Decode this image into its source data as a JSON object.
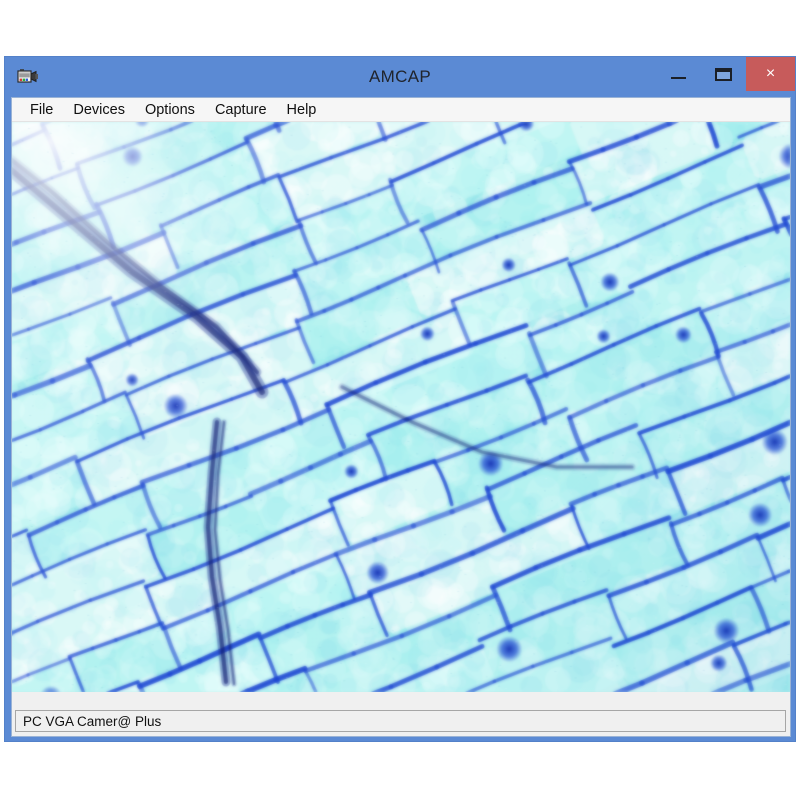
{
  "window": {
    "title": "AMCAP",
    "icon": "camcorder-icon",
    "controls": {
      "minimize": "—",
      "maximize": "❐",
      "close": "×"
    }
  },
  "menu": {
    "items": [
      {
        "label": "File"
      },
      {
        "label": "Devices"
      },
      {
        "label": "Options"
      },
      {
        "label": "Capture"
      },
      {
        "label": "Help"
      }
    ]
  },
  "preview": {
    "description": "Live camera preview of onion epidermis cells under microscope",
    "cell_wall_color": "#1b44d2",
    "cell_interior_color": "#b6f2ef",
    "nucleus_color": "#1634b4",
    "highlight_color": "#ffffff"
  },
  "statusbar": {
    "device": "PC VGA Camer@ Plus"
  },
  "colors": {
    "titlebar": "#5b8ad4",
    "close_button": "#c75b5b",
    "menubar": "#f6f6f6",
    "statusbar": "#f0f0f0",
    "desktop": "#ffffff"
  }
}
